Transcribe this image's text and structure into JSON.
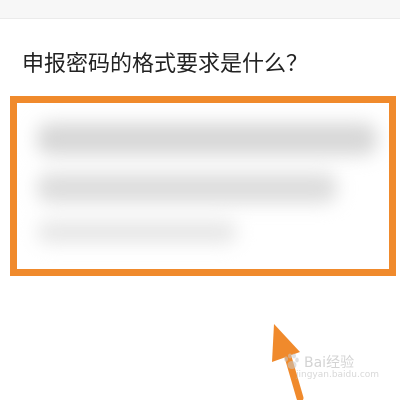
{
  "question": {
    "text": "申报密码的格式要求是什么？"
  },
  "answer_box": {
    "border_color": "#f08a2c",
    "content": "blurred"
  },
  "annotation": {
    "arrow_color": "#f08a2c",
    "icon": "arrow-up-left-icon"
  },
  "watermark": {
    "text": "Bai经验",
    "url": "jingyan.baidu.com",
    "icon": "baidu-paw-logo"
  }
}
